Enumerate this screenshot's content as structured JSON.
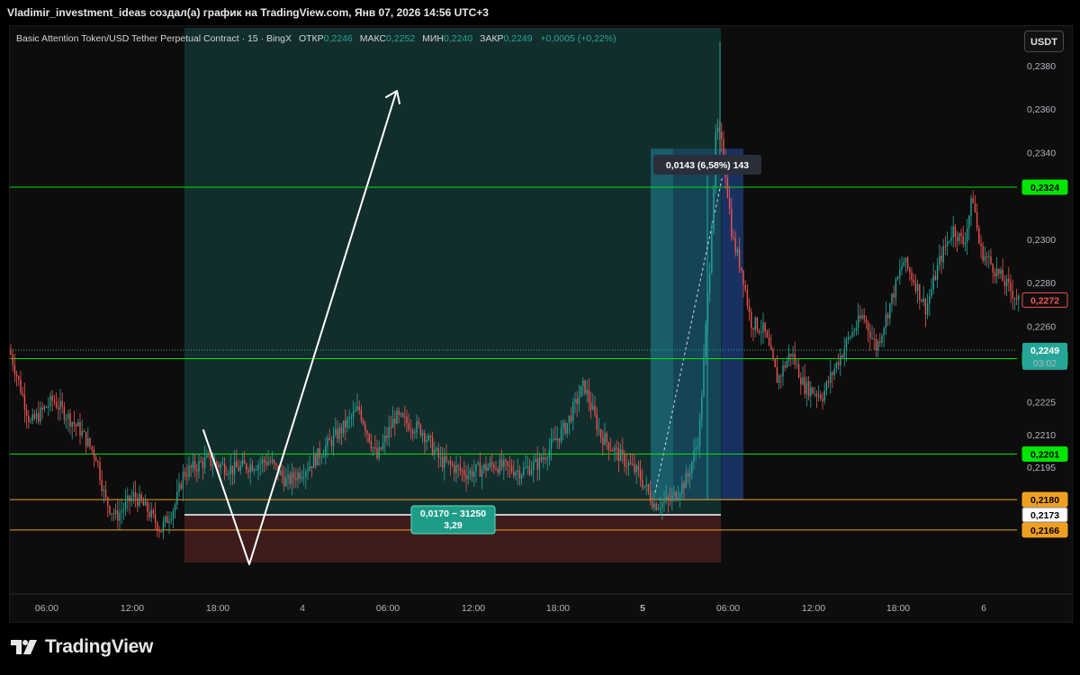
{
  "header": {
    "text": "Vladimir_investment_ideas создал(а) график на TradingView.com, Янв 07, 2026 14:56 UTC+3"
  },
  "legend": {
    "symbol": "Basic Attention Token/USD Tether Perpetual Contract · 15 · BingX",
    "open_label": "ОТКР",
    "open": "0,2246",
    "high_label": "МАКС",
    "high": "0,2252",
    "low_label": "МИН",
    "low": "0,2240",
    "close_label": "ЗАКР",
    "close": "0,2249",
    "change": "+0,0005 (+0,22%)"
  },
  "currency_button": "USDT",
  "footer": {
    "brand": "TradingView"
  },
  "colors": {
    "up": "#26a69a",
    "down": "#ef5350",
    "green_line": "#00e600",
    "orange_line": "#f0a020"
  },
  "chart_data": {
    "type": "candlestick",
    "y_axis": {
      "min": 0.2145,
      "max": 0.2392,
      "ticks": [
        "0,2380",
        "0,2360",
        "0,2340",
        "0,2300",
        "0,2280",
        "0,2260",
        "0,2225",
        "0,2210",
        "0,2195"
      ],
      "tick_values": [
        0.238,
        0.236,
        0.234,
        0.23,
        0.228,
        0.226,
        0.2225,
        0.221,
        0.2195
      ]
    },
    "x_axis": {
      "labels": [
        "06:00",
        "12:00",
        "18:00",
        "4",
        "06:00",
        "12:00",
        "18:00",
        "5",
        "06:00",
        "12:00",
        "18:00",
        "6"
      ],
      "bold": [
        false,
        false,
        false,
        false,
        false,
        false,
        false,
        true,
        false,
        false,
        false,
        false
      ]
    },
    "horizontal_levels": [
      {
        "label": "0,2324",
        "value": 0.2324,
        "color": "green"
      },
      {
        "label": "0,2245",
        "value": 0.2245,
        "color": "green"
      },
      {
        "label": "0,2201",
        "value": 0.2201,
        "color": "green"
      },
      {
        "label": "0,2180",
        "value": 0.218,
        "color": "orange"
      },
      {
        "label": "0,2166",
        "value": 0.2166,
        "color": "orange"
      },
      {
        "label": "0,2173",
        "value": 0.2173,
        "color": "white"
      }
    ],
    "price_labels": {
      "last": {
        "value": 0.2249,
        "price": "0,2249",
        "countdown": "03:02"
      },
      "line": {
        "value": 0.2272,
        "price": "0,2272"
      }
    },
    "position_tool": {
      "label_line1": "0,0170 − 31250",
      "label_line2": "3,29",
      "entry": 0.2173,
      "target": 0.2392,
      "stop": 0.216
    },
    "range_measure": {
      "label": "0,0143 (6,58%) 143",
      "from": 0.218,
      "to": 0.2343
    },
    "candles_summary": [
      {
        "segment": "day3_open",
        "start": 0.225,
        "end": 0.2195
      },
      {
        "segment": "day3_low",
        "start": 0.218,
        "end": 0.217
      },
      {
        "segment": "day4_range",
        "start": 0.2195,
        "end": 0.2225
      },
      {
        "segment": "day4_peak",
        "start": 0.2235,
        "end": 0.22
      },
      {
        "segment": "day5_pump",
        "start": 0.2178,
        "end": 0.2365
      },
      {
        "segment": "day5_drop",
        "start": 0.234,
        "end": 0.223
      },
      {
        "segment": "day5_recover",
        "start": 0.224,
        "end": 0.2315
      },
      {
        "segment": "day6",
        "start": 0.2315,
        "end": 0.2272
      }
    ]
  }
}
